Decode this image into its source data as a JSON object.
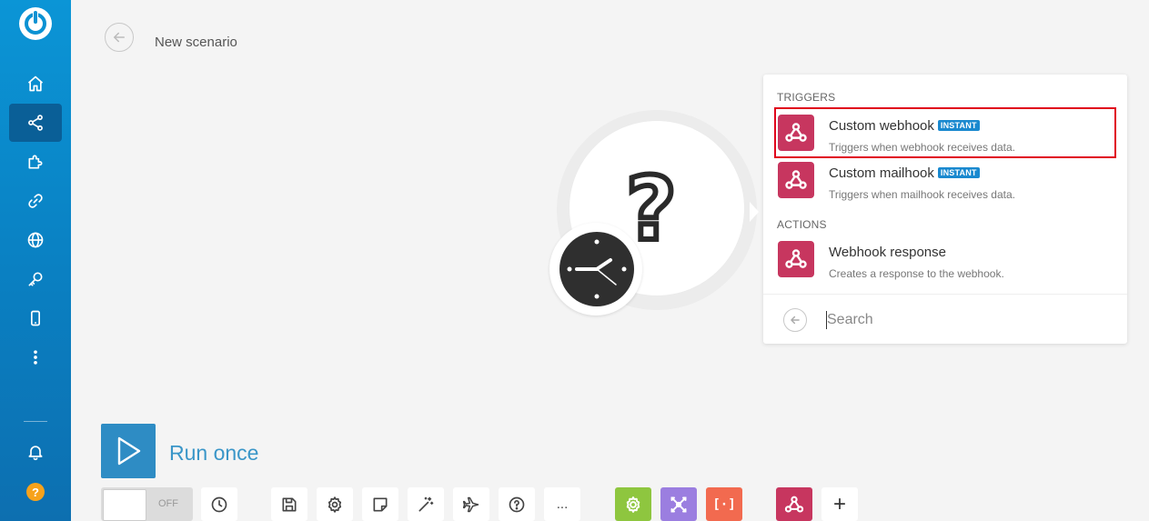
{
  "sidebar": {
    "logo": "make-logo-icon",
    "items": [
      {
        "icon": "home-icon",
        "active": false
      },
      {
        "icon": "share-icon",
        "active": true
      },
      {
        "icon": "puzzle-icon",
        "active": false
      },
      {
        "icon": "link-icon",
        "active": false
      },
      {
        "icon": "globe-icon",
        "active": false
      },
      {
        "icon": "key-icon",
        "active": false
      },
      {
        "icon": "mobile-icon",
        "active": false
      },
      {
        "icon": "more-icon",
        "active": false
      }
    ],
    "bottom": [
      {
        "icon": "bell-icon"
      },
      {
        "icon": "help-icon",
        "label": "?"
      }
    ]
  },
  "header": {
    "title": "New scenario"
  },
  "canvas": {
    "module_icon": "question-mark-icon",
    "schedule_icon": "clock-icon",
    "question_glyph": "?"
  },
  "picker": {
    "sections": [
      {
        "label": "TRIGGERS",
        "items": [
          {
            "title": "Custom webhook",
            "badge": "INSTANT",
            "description": "Triggers when webhook receives data.",
            "icon": "webhook-icon",
            "highlighted": true
          },
          {
            "title": "Custom mailhook",
            "badge": "INSTANT",
            "description": "Triggers when mailhook receives data.",
            "icon": "webhook-icon",
            "highlighted": false
          }
        ]
      },
      {
        "label": "ACTIONS",
        "items": [
          {
            "title": "Webhook response",
            "badge": "",
            "description": "Creates a response to the webhook.",
            "icon": "webhook-icon",
            "highlighted": false
          }
        ]
      }
    ],
    "search": {
      "placeholder": "Search",
      "value": ""
    }
  },
  "controls": {
    "run_label": "Run once",
    "toggle_label": "OFF",
    "toolbar": [
      {
        "icon": "clock-icon"
      },
      {
        "icon": "save-icon"
      },
      {
        "icon": "settings-icon"
      },
      {
        "icon": "note-icon"
      },
      {
        "icon": "magic-wand-icon"
      },
      {
        "icon": "airplane-icon"
      },
      {
        "icon": "question-icon"
      },
      {
        "icon": "ellipsis-icon",
        "label": "..."
      }
    ],
    "tools": [
      {
        "icon": "tools-gear-icon",
        "color": "#8ec63f"
      },
      {
        "icon": "flow-control-icon",
        "color": "#9b7ee0"
      },
      {
        "icon": "text-parser-icon",
        "color": "#f26a4f",
        "label": "[·]"
      },
      {
        "icon": "webhook-icon",
        "color": "#c7365f"
      }
    ],
    "add_label": "+"
  },
  "colors": {
    "sidebar": "#0b95d6",
    "accent": "#2e8cc4",
    "webhook": "#c7365f",
    "highlight": "#e0001b",
    "badge": "#1a89cf"
  }
}
